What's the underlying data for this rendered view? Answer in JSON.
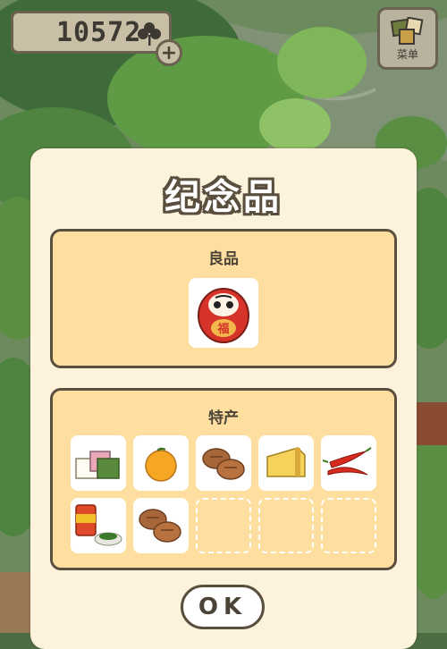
{
  "hud": {
    "clover_count": "10572",
    "plus_symbol": "+",
    "menu_label": "菜单"
  },
  "dialog": {
    "title": "纪念品",
    "good_section": {
      "title": "良品",
      "items": [
        {
          "name": "daruma-doll",
          "label": "福"
        }
      ]
    },
    "special_section": {
      "title": "特产",
      "items": [
        {
          "name": "layered-rice-cakes"
        },
        {
          "name": "mandarin-orange"
        },
        {
          "name": "steamed-buns"
        },
        {
          "name": "cheese-wedge"
        },
        {
          "name": "red-chili-peppers"
        },
        {
          "name": "canned-tea-with-leaves"
        },
        {
          "name": "manju-buns"
        }
      ],
      "empty_slots": 3
    },
    "ok_label": "OK"
  },
  "colors": {
    "panel_fill": "#ffdfa0",
    "dialog_bg": "#fdf3dc",
    "outline": "#5a4f3e"
  }
}
